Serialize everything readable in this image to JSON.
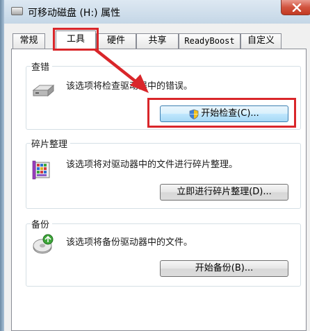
{
  "window": {
    "title": "可移动磁盘 (H:) 属性"
  },
  "tabs": [
    {
      "label": "常规",
      "active": false
    },
    {
      "label": "工具",
      "active": true
    },
    {
      "label": "硬件",
      "active": false
    },
    {
      "label": "共享",
      "active": false
    },
    {
      "label": "ReadyBoost",
      "active": false
    },
    {
      "label": "自定义",
      "active": false
    }
  ],
  "error_check": {
    "title": "查错",
    "description": "该选项将检查驱动器中的错误。",
    "button_label": "开始检查(C)...",
    "icon": "drive-icon"
  },
  "defrag": {
    "title": "碎片整理",
    "description": "该选项将对驱动器中的文件进行碎片整理。",
    "button_label": "立即进行碎片整理(D)...",
    "icon": "defrag-icon"
  },
  "backup": {
    "title": "备份",
    "description": "该选项将备份驱动器中的文件。",
    "button_label": "开始备份(B)...",
    "icon": "backup-icon"
  },
  "annotation": {
    "color": "#d9262a"
  }
}
